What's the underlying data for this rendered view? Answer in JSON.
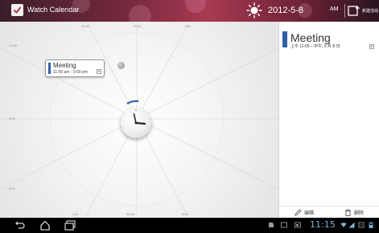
{
  "header": {
    "app_title": "Watch Calendar",
    "date": "2012-5-8",
    "ampm_toggle": "AM",
    "new_event_label": "新建活动"
  },
  "dial": {
    "hour_labels": {
      "top_left": "11:00",
      "top_center": "12:00",
      "top_right": "1:00",
      "left_upper": "10:00",
      "left_middle": "9:00",
      "left_lower": "8:00",
      "bottom_left": "7:00",
      "bottom_center": "06:00",
      "bottom_right": "5:00"
    },
    "event_card": {
      "title": "Meeting",
      "time": "11:00 am - 0:00 pm",
      "color": "#2f5fa8"
    }
  },
  "detail_panel": {
    "title": "Meeting",
    "time": "上午 11:00 – 中午, 5 月 8 日",
    "edit_label": "编辑",
    "delete_label": "删除"
  },
  "system_bar": {
    "clock": "11:15"
  },
  "colors": {
    "accent": "#2f5fa8",
    "topbar": "#a83a52",
    "status_text": "#7fb2d6"
  }
}
